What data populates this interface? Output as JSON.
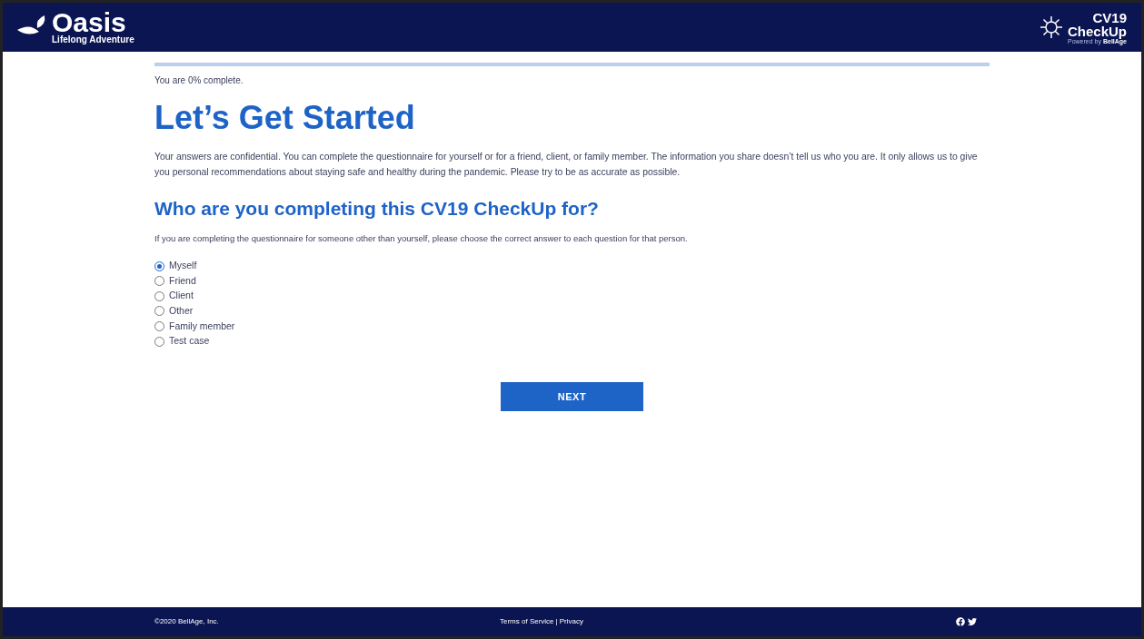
{
  "header": {
    "logo": {
      "name": "Oasis",
      "tagline": "Lifelong Adventure"
    },
    "partner_logo": {
      "name_1": "CV19",
      "name_2": "CheckUp",
      "powered_by": "Powered by",
      "company": "BellAge"
    }
  },
  "progress": {
    "level": 0,
    "label": "You are 0% complete."
  },
  "title": "Let’s Get Started",
  "intro": "Your answers are confidential. You can complete the questionnaire for yourself or for a friend, client, or family member. The information you share doesn’t tell us who you are. It only allows us to give you personal recommendations about staying safe and healthy during the pandemic. Please try to be as accurate as possible.",
  "question": {
    "title": "Who are you completing this CV19 CheckUp for?",
    "hint": "If you are completing the questionnaire for someone other than yourself, please choose the correct answer to each question for that person.",
    "options": [
      {
        "label": "Myself",
        "selected": true
      },
      {
        "label": "Friend",
        "selected": false
      },
      {
        "label": "Client",
        "selected": false
      },
      {
        "label": "Other",
        "selected": false
      },
      {
        "label": "Family member",
        "selected": false
      },
      {
        "label": "Test case",
        "selected": false
      }
    ]
  },
  "next_button": "NEXT",
  "footer": {
    "copyright": "©2020 BellAge, Inc.",
    "links": [
      "Terms of Service",
      "Privacy"
    ],
    "separator": "|"
  }
}
